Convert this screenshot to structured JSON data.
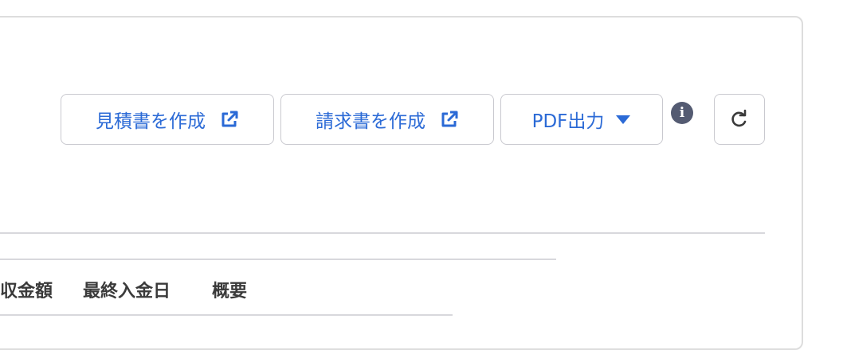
{
  "toolbar": {
    "create_estimate_label": "見積書を作成",
    "create_invoice_label": "請求書を作成",
    "pdf_export_label": "PDF出力",
    "info_glyph": "i"
  },
  "table": {
    "columns": [
      "収金額",
      "最終入金日",
      "概要"
    ]
  },
  "colors": {
    "accent": "#2b6ad6",
    "border": "#c9c9cf",
    "info_badge": "#545b72"
  },
  "icons": {
    "external_link": "external-link-icon",
    "dropdown": "caret-down-icon",
    "info": "info-icon",
    "refresh": "refresh-icon"
  }
}
